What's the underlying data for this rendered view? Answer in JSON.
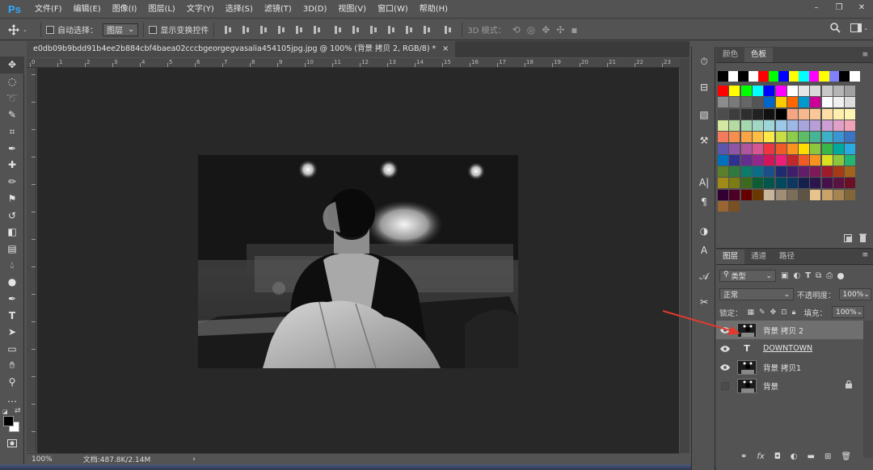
{
  "app": {
    "logo": "Ps"
  },
  "menu": [
    "文件(F)",
    "编辑(E)",
    "图像(I)",
    "图层(L)",
    "文字(Y)",
    "选择(S)",
    "滤镜(T)",
    "3D(D)",
    "视图(V)",
    "窗口(W)",
    "帮助(H)"
  ],
  "window_controls": {
    "minimize": "–",
    "restore": "❐",
    "close": "✕"
  },
  "options": {
    "auto_select_label": "自动选择：",
    "auto_select_value": "图层",
    "show_transform_label": "显示变换控件",
    "mode_3d_label": "3D 模式："
  },
  "document": {
    "tab_title": "e0db09b9bdd91b4ee2b884cbf4baea02cccbgeorgegvasalia454105jpg.jpg @ 100% (背景 拷贝 2, RGB/8) *",
    "tab_close": "×",
    "zoom": "100%",
    "doc_size": "文档:487.8K/2.14M"
  },
  "ruler_top_ticks": [
    "0",
    "1",
    "2",
    "3",
    "4",
    "5",
    "6",
    "7",
    "8",
    "9",
    "10",
    "11",
    "12",
    "13",
    "14",
    "15",
    "16",
    "17",
    "18",
    "19",
    "20",
    "21",
    "22",
    "23"
  ],
  "swatch_panel": {
    "tabs": [
      "颜色",
      "色板"
    ],
    "active_tab": 1,
    "rows": [
      [
        "#000000",
        "#ffffff",
        "#000000",
        "#ffffff",
        "#ff0000",
        "#00ff00",
        "#0000ff",
        "#ffff00",
        "#00ffff",
        "#ff00ff",
        "#ffff00",
        "#8080ff",
        "#000000",
        "#ffffff"
      ],
      [
        "#ff0000",
        "#ffff00",
        "#00ff00",
        "#00ffff",
        "#0000ff",
        "#ff00ff",
        "#ffffff",
        "#e6e6e6",
        "#d9d9d9",
        "#c8c8c8",
        "#b5b5b5",
        "#a0a0a0"
      ],
      [
        "#8c8c8c",
        "#7a7a7a",
        "#666666",
        "#555555",
        "#0066cc",
        "#ffcc00",
        "#ff6600",
        "#0099cc",
        "#cc0099",
        "#ffffff",
        "#f0f0f0",
        "#dddddd"
      ],
      [
        "#4d4d4d",
        "#3d3d3d",
        "#2e2e2e",
        "#222222",
        "#111111",
        "#000000",
        "#f4a582",
        "#f6b88c",
        "#fac898",
        "#fee0a6",
        "#ffeead",
        "#fff5b0"
      ],
      [
        "#d4e8a0",
        "#b5dba2",
        "#a6d8b0",
        "#9fd6c4",
        "#9dd5d8",
        "#9cc9e8",
        "#9db7e6",
        "#a7a5dc",
        "#b79ed6",
        "#cc9ed3",
        "#e0a0c8",
        "#f0a3b8"
      ],
      [
        "#f37b5b",
        "#f68e50",
        "#f9a445",
        "#fdbe44",
        "#fde84c",
        "#c9dd45",
        "#8fcb4c",
        "#5cbd66",
        "#45b596",
        "#3bb0c6",
        "#3a96d3",
        "#3b75c2"
      ],
      [
        "#5e56aa",
        "#8f55a6",
        "#b2559f",
        "#d65592",
        "#ee3542",
        "#f05a28",
        "#f7931e",
        "#ffdd00",
        "#8dc63f",
        "#39b54a",
        "#00a99d",
        "#29abe2"
      ],
      [
        "#0071bc",
        "#2e3192",
        "#662d91",
        "#92278f",
        "#d4145a",
        "#ed1e79",
        "#c1272d",
        "#f15a24",
        "#f7931e",
        "#d9e021",
        "#8cc63f",
        "#22b573"
      ],
      [
        "#5b7f2a",
        "#2f7a3f",
        "#0b7b6a",
        "#0a6e8b",
        "#1a4f8a",
        "#212c6f",
        "#3d1f6b",
        "#5f1d6a",
        "#7d1a57",
        "#9e1b2b",
        "#a63a17",
        "#a2641a"
      ],
      [
        "#a18a16",
        "#7a7c14",
        "#3d6b1d",
        "#0e5c34",
        "#04564c",
        "#03495e",
        "#0e3760",
        "#16204c",
        "#2b164b",
        "#45134a",
        "#5a1240",
        "#6b0f24"
      ],
      [
        "#330033",
        "#4d0026",
        "#660000",
        "#6b3800",
        "#c8b59a",
        "#a08e76",
        "#7d6e5b",
        "#5e5345",
        "#e7c48b",
        "#c9a36a",
        "#a6844f",
        "#82663a"
      ],
      [
        "#996633",
        "#7a4f22"
      ]
    ]
  },
  "layers_panel": {
    "tabs": [
      "图层",
      "通道",
      "路径"
    ],
    "active_tab": 0,
    "filter_kind": "类型",
    "blend_mode": "正常",
    "opacity_label": "不透明度：",
    "opacity_value": "100%",
    "lock_label": "锁定：",
    "fill_label": "填充：",
    "fill_value": "100%",
    "layers": [
      {
        "name": "背景 拷贝 2",
        "visible": true,
        "kind": "image",
        "selected": true
      },
      {
        "name": "DOWNTOWN",
        "visible": true,
        "kind": "text",
        "selected": false
      },
      {
        "name": "背景 拷贝1",
        "visible": true,
        "kind": "image",
        "selected": false
      },
      {
        "name": "背景",
        "visible": false,
        "kind": "image",
        "selected": false,
        "locked": true
      }
    ],
    "footer_icons": [
      "link-icon",
      "fx-icon",
      "mask-icon",
      "adjustment-icon",
      "folder-icon",
      "new-layer-icon",
      "trash-icon"
    ]
  },
  "colors": {
    "accent": "#31a8ff",
    "arrow": "#e03a2e"
  }
}
